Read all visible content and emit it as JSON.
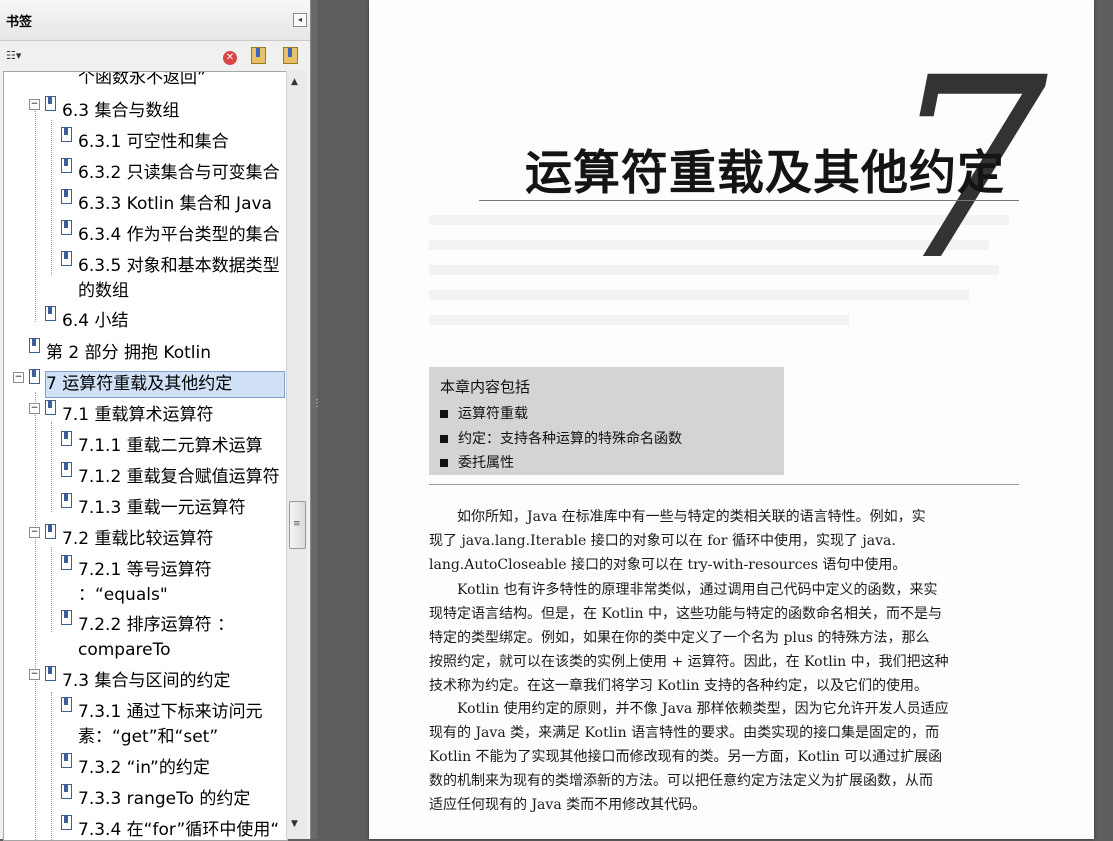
{
  "panel": {
    "title": "书签",
    "collapse_icon": "◂",
    "options_icon": "☷▾",
    "delete_icon": "✕",
    "expand_icon": "bookmark-expand-icon",
    "new_icon": "bookmark-new-icon"
  },
  "bookmarks": [
    {
      "label": "个函数永不返回”"
    },
    {
      "label": "6.3 集合与数组"
    },
    {
      "label": "6.3.1 可空性和集合"
    },
    {
      "label": "6.3.2 只读集合与可变集合"
    },
    {
      "label": "6.3.3 Kotlin 集合和 Java"
    },
    {
      "label": "6.3.4 作为平台类型的集合"
    },
    {
      "label": "6.3.5 对象和基本数据类型的数组"
    },
    {
      "label": "6.4 小结"
    },
    {
      "label": "第 2 部分 拥抱 Kotlin"
    },
    {
      "label": "7 运算符重载及其他约定"
    },
    {
      "label": "7.1 重载算术运算符"
    },
    {
      "label": "7.1.1 重载二元算术运算"
    },
    {
      "label": "7.1.2 重载复合赋值运算符"
    },
    {
      "label": "7.1.3 重载一元运算符"
    },
    {
      "label": "7.2 重载比较运算符"
    },
    {
      "label": "7.2.1 等号运算符 ：“equals\""
    },
    {
      "label": "7.2.2 排序运算符 ：compareTo"
    },
    {
      "label": "7.3 集合与区间的约定"
    },
    {
      "label": "7.3.1 通过下标来访问元素：“get”和“set”"
    },
    {
      "label": "7.3.2 “in”的约定"
    },
    {
      "label": "7.3.3 rangeTo 的约定"
    },
    {
      "label": "7.3.4 在“for”循环中使用“"
    }
  ],
  "scrollbar": {
    "up": "▲",
    "down": "▼",
    "grip": "≡"
  },
  "splitter_grip": "⋮",
  "page": {
    "chapter_number": "7",
    "chapter_title": "运算符重载及其他约定",
    "summary": {
      "heading": "本章内容包括",
      "items": [
        "运算符重载",
        "约定：支持各种运算的特殊命名函数",
        "委托属性"
      ]
    },
    "paragraphs": [
      [
        "　　如你所知，Java 在标准库中有一些与特定的类相关联的语言特性。例如，实",
        "现了 java.lang.Iterable 接口的对象可以在 for 循环中使用，实现了 java.",
        "lang.AutoCloseable 接口的对象可以在 try-with-resources 语句中使用。"
      ],
      [
        "　　Kotlin 也有许多特性的原理非常类似，通过调用自己代码中定义的函数，来实",
        "现特定语言结构。但是，在 Kotlin 中，这些功能与特定的函数命名相关，而不是与",
        "特定的类型绑定。例如，如果在你的类中定义了一个名为 plus 的特殊方法，那么",
        "按照约定，就可以在该类的实例上使用 + 运算符。因此，在 Kotlin 中，我们把这种",
        "技术称为约定。在这一章我们将学习 Kotlin 支持的各种约定，以及它们的使用。"
      ],
      [
        "　　Kotlin 使用约定的原则，并不像 Java 那样依赖类型，因为它允许开发人员适应",
        "现有的 Java 类，来满足 Kotlin 语言特性的要求。由类实现的接口集是固定的，而",
        "Kotlin 不能为了实现其他接口而修改现有的类。另一方面，Kotlin 可以通过扩展函",
        "数的机制来为现有的类增添新的方法。可以把任意约定方法定义为扩展函数，从而",
        "适应任何现有的 Java 类而不用修改其代码。"
      ]
    ]
  }
}
